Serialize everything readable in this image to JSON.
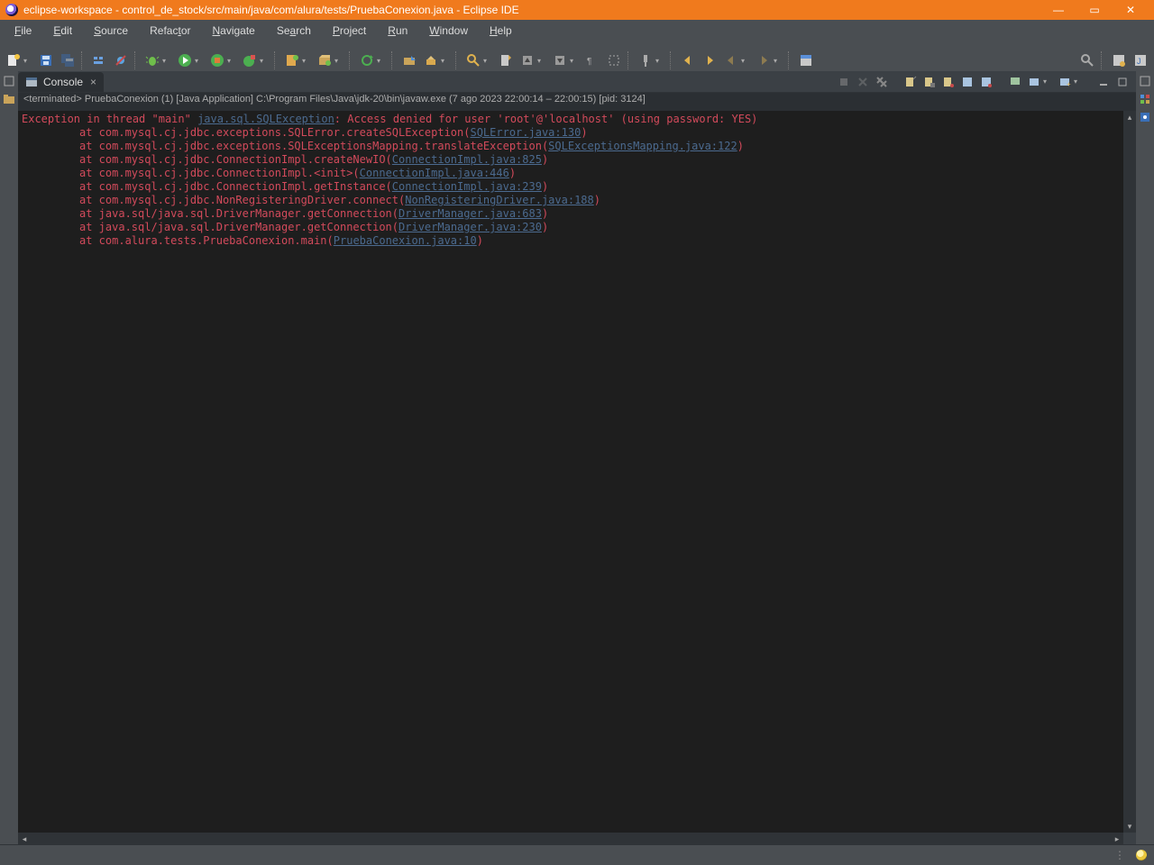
{
  "title": "eclipse-workspace - control_de_stock/src/main/java/com/alura/tests/PruebaConexion.java - Eclipse IDE",
  "menu": [
    "File",
    "Edit",
    "Source",
    "Refactor",
    "Navigate",
    "Search",
    "Project",
    "Run",
    "Window",
    "Help"
  ],
  "console": {
    "tab_label": "Console",
    "proc_line": "<terminated> PruebaConexion (1) [Java Application] C:\\Program Files\\Java\\jdk-20\\bin\\javaw.exe  (7 ago 2023 22:00:14 – 22:00:15) [pid: 3124]",
    "head_pre": "Exception in thread \"main\" ",
    "head_link": "java.sql.SQLException",
    "head_post": ": Access denied for user 'root'@'localhost' (using password: YES)",
    "trace": [
      {
        "m": "at com.mysql.cj.jdbc.exceptions.SQLError.createSQLException(",
        "l": "SQLError.java:130",
        "e": ")"
      },
      {
        "m": "at com.mysql.cj.jdbc.exceptions.SQLExceptionsMapping.translateException(",
        "l": "SQLExceptionsMapping.java:122",
        "e": ")"
      },
      {
        "m": "at com.mysql.cj.jdbc.ConnectionImpl.createNewIO(",
        "l": "ConnectionImpl.java:825",
        "e": ")"
      },
      {
        "m": "at com.mysql.cj.jdbc.ConnectionImpl.<init>(",
        "l": "ConnectionImpl.java:446",
        "e": ")"
      },
      {
        "m": "at com.mysql.cj.jdbc.ConnectionImpl.getInstance(",
        "l": "ConnectionImpl.java:239",
        "e": ")"
      },
      {
        "m": "at com.mysql.cj.jdbc.NonRegisteringDriver.connect(",
        "l": "NonRegisteringDriver.java:188",
        "e": ")"
      },
      {
        "m": "at java.sql/java.sql.DriverManager.getConnection(",
        "l": "DriverManager.java:683",
        "e": ")"
      },
      {
        "m": "at java.sql/java.sql.DriverManager.getConnection(",
        "l": "DriverManager.java:230",
        "e": ")"
      },
      {
        "m": "at com.alura.tests.PruebaConexion.main(",
        "l": "PruebaConexion.java:10",
        "e": ")"
      }
    ]
  },
  "toolbar_icons": [
    "new",
    "save",
    "save-all",
    "print",
    "sep",
    "toggle-breadcrumb",
    "skip-breakpoints",
    "sep",
    "debug",
    "run",
    "coverage",
    "run-external",
    "sep",
    "new-class",
    "new-package",
    "sep",
    "refresh",
    "sep",
    "open-type",
    "open-task",
    "sep",
    "search",
    "toggle-mark",
    "annotation-prev",
    "annotation-next",
    "show-whitespace",
    "block-select",
    "sep",
    "pin",
    "sep",
    "back-history",
    "fwd-history",
    "back",
    "fwd",
    "sep",
    "open-perspective"
  ],
  "console_toolbar": [
    "terminate",
    "remove-launch",
    "remove-all",
    "|",
    "clear",
    "scroll-lock",
    "word-wrap",
    "show-on-out",
    "show-on-err",
    "|",
    "pin-console",
    "display-selected",
    "open-console",
    "|",
    "minimize",
    "maximize"
  ],
  "colors": {
    "accent": "#f07a1d",
    "err": "#d24a5b",
    "link": "#4b6a8f",
    "bg": "#1e1e1e"
  }
}
